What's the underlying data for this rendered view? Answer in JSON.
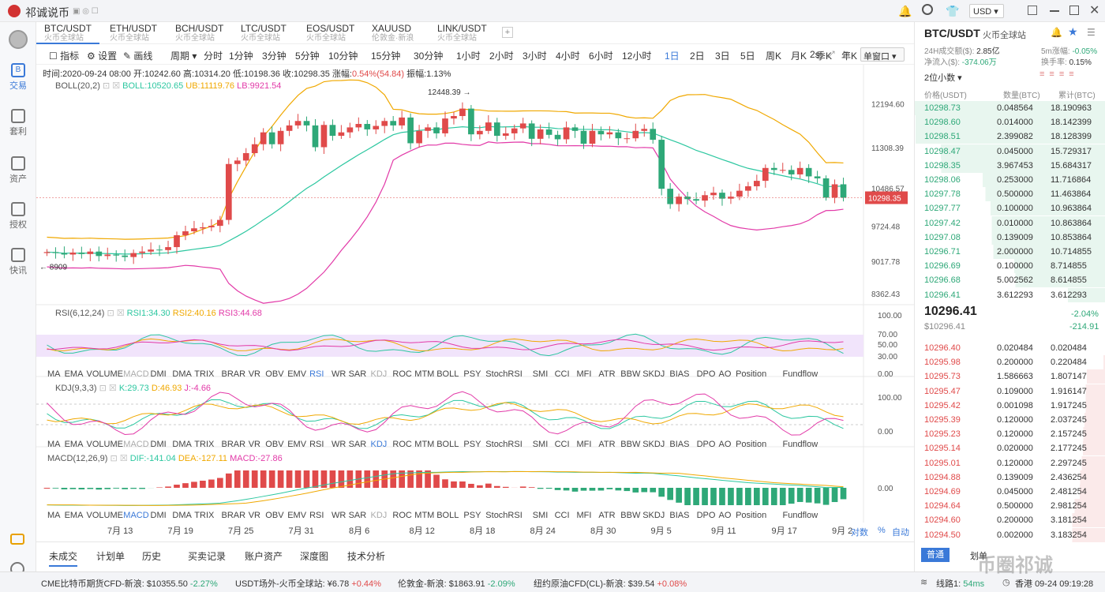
{
  "app": {
    "title": "祁诚说币",
    "currency": "USD"
  },
  "nav": [
    {
      "label": "交易",
      "icon": "trade-icon"
    },
    {
      "label": "套利",
      "icon": "arbitrage-icon"
    },
    {
      "label": "资产",
      "icon": "wallet-icon"
    },
    {
      "label": "授权",
      "icon": "key-icon"
    },
    {
      "label": "快讯",
      "icon": "news-icon"
    }
  ],
  "tabs": [
    {
      "pair": "BTC/USDT",
      "ex": "火币全球站"
    },
    {
      "pair": "ETH/USDT",
      "ex": "火币全球站"
    },
    {
      "pair": "BCH/USDT",
      "ex": "火币全球站"
    },
    {
      "pair": "LTC/USDT",
      "ex": "火币全球站"
    },
    {
      "pair": "EOS/USDT",
      "ex": "火币全球站"
    },
    {
      "pair": "XAUUSD",
      "ex": "伦敦金·新浪"
    },
    {
      "pair": "LINK/USDT",
      "ex": "火币全球站"
    }
  ],
  "toolbar": {
    "indicator": "指标",
    "settings": "设置",
    "draw": "画线",
    "period": "周期",
    "intervals": [
      "分时",
      "1分钟",
      "3分钟",
      "5分钟",
      "10分钟",
      "15分钟",
      "30分钟",
      "1小时",
      "2小时",
      "3小时",
      "4小时",
      "6小时",
      "12小时",
      "1日",
      "2日",
      "3日",
      "5日",
      "周K",
      "月K",
      "季K",
      "年K"
    ],
    "active": "1日",
    "refresh": "2s",
    "window": "单窗口"
  },
  "info": {
    "line": "时间:2020-09-24 08:00  开:10242.60  高:10314.20  低:10198.36  收:10298.35  涨幅:",
    "pct": "0.54%(54.84)",
    "amp": "振幅:1.13%"
  },
  "boll": {
    "name": "BOLL(20,2)",
    "boll": "BOLL:10520.65",
    "ub": "UB:11119.76",
    "lb": "LB:9921.54"
  },
  "rsi": {
    "name": "RSI(6,12,24)",
    "r1": "RSI1:34.30",
    "r2": "RSI2:40.16",
    "r3": "RSI3:44.68"
  },
  "kdj": {
    "name": "KDJ(9,3,3)",
    "k": "K:29.73",
    "d": "D:46.93",
    "j": "J:-4.66"
  },
  "macd": {
    "name": "MACD(12,26,9)",
    "dif": "DIF:-141.04",
    "dea": "DEA:-127.11",
    "m": "MACD:-27.86"
  },
  "indicators": [
    "MA",
    "EMA",
    "VOLUME",
    "MACD",
    "DMI",
    "DMA",
    "TRIX",
    "BRAR",
    "VR",
    "OBV",
    "EMV",
    "RSI",
    "WR",
    "SAR",
    "KDJ",
    "ROC",
    "MTM",
    "BOLL",
    "PSY",
    "StochRSI",
    "SMI",
    "CCI",
    "MFI",
    "ATR",
    "BBW",
    "SKDJ",
    "BIAS",
    "DPO",
    "AO",
    "Position",
    "Fundflow"
  ],
  "yaxis": {
    "main": [
      "12194.60",
      "11308.39",
      "10486.57",
      "9724.48",
      "9017.78",
      "8362.43"
    ],
    "last": "10298.35",
    "rsi": [
      "100.00",
      "70.00",
      "50.00",
      "30.00",
      "0.00"
    ],
    "kdj": [
      "100.00",
      "0.00"
    ],
    "macd": [
      "0.00"
    ]
  },
  "markers": {
    "high": "12448.39",
    "low": "8909"
  },
  "xaxis": [
    "7月 13",
    "7月 19",
    "7月 25",
    "7月 31",
    "8月 6",
    "8月 12",
    "8月 18",
    "8月 24",
    "8月 30",
    "9月 5",
    "9月 11",
    "9月 17",
    "9月 2"
  ],
  "axis_opts": {
    "log": "对数",
    "pct": "%",
    "auto": "自动"
  },
  "bottom_tabs": [
    "未成交",
    "计划单",
    "历史",
    "买卖记录",
    "账户资产",
    "深度图",
    "技术分析"
  ],
  "right": {
    "pair": "BTC/USDT",
    "ex": "火币全球站",
    "vol_label": "24H成交额($):",
    "vol": "2.85亿",
    "flow_label": "净流入($):",
    "flow": "-374.06万",
    "m5_label": "5m涨幅:",
    "m5": "-0.05%",
    "turn_label": "换手率:",
    "turn": "0.15%",
    "decimals": "2位小数",
    "cols": [
      "价格(USDT)",
      "数量(BTC)",
      "累计(BTC)"
    ],
    "asks": [
      [
        "10298.73",
        "0.048564",
        "18.190963"
      ],
      [
        "10298.60",
        "0.014000",
        "18.142399"
      ],
      [
        "10298.51",
        "2.399082",
        "18.128399"
      ],
      [
        "10298.47",
        "0.045000",
        "15.729317"
      ],
      [
        "10298.35",
        "3.967453",
        "15.684317"
      ],
      [
        "10298.06",
        "0.253000",
        "11.716864"
      ],
      [
        "10297.78",
        "0.500000",
        "11.463864"
      ],
      [
        "10297.77",
        "0.100000",
        "10.963864"
      ],
      [
        "10297.42",
        "0.010000",
        "10.863864"
      ],
      [
        "10297.08",
        "0.139009",
        "10.853864"
      ],
      [
        "10296.71",
        "2.000000",
        "10.714855"
      ],
      [
        "10296.69",
        "0.100000",
        "8.714855"
      ],
      [
        "10296.68",
        "5.002562",
        "8.614855"
      ],
      [
        "10296.41",
        "3.612293",
        "3.612293"
      ]
    ],
    "last": "10296.41",
    "last_usd": "$10296.41",
    "chg": "-2.04%",
    "chg_abs": "-214.91",
    "bids": [
      [
        "10296.40",
        "0.020484",
        "0.020484"
      ],
      [
        "10295.98",
        "0.200000",
        "0.220484"
      ],
      [
        "10295.73",
        "1.586663",
        "1.807147"
      ],
      [
        "10295.47",
        "0.109000",
        "1.916147"
      ],
      [
        "10295.42",
        "0.001098",
        "1.917245"
      ],
      [
        "10295.39",
        "0.120000",
        "2.037245"
      ],
      [
        "10295.23",
        "0.120000",
        "2.157245"
      ],
      [
        "10295.14",
        "0.020000",
        "2.177245"
      ],
      [
        "10295.01",
        "0.120000",
        "2.297245"
      ],
      [
        "10294.88",
        "0.139009",
        "2.436254"
      ],
      [
        "10294.69",
        "0.045000",
        "2.481254"
      ],
      [
        "10294.64",
        "0.500000",
        "2.981254"
      ],
      [
        "10294.60",
        "0.200000",
        "3.181254"
      ],
      [
        "10294.50",
        "0.002000",
        "3.183254"
      ]
    ],
    "mode": "普通",
    "mode2": "划单"
  },
  "ticker": [
    {
      "name": "CME比特币期货CFD-新浪:",
      "price": "$10355.50",
      "chg": "-2.27%",
      "dir": "down"
    },
    {
      "name": "USDT场外-火币全球站:",
      "price": "¥6.78",
      "chg": "+0.44%",
      "dir": "up"
    },
    {
      "name": "伦敦金-新浪:",
      "price": "$1863.91",
      "chg": "-2.09%",
      "dir": "down"
    },
    {
      "name": "纽约原油CFD(CL)-新浪:",
      "price": "$39.54",
      "chg": "+0.08%",
      "dir": "up"
    }
  ],
  "status": {
    "line": "线路1:",
    "ping": "54ms",
    "region": "香港",
    "time": "09-24 09:19:28"
  },
  "watermark": "币圈祁诚",
  "chart_data": {
    "type": "candlestick",
    "closes": [
      9200,
      9180,
      9150,
      9190,
      9160,
      9210,
      9120,
      9150,
      9130,
      9100,
      9180,
      9210,
      9250,
      9240,
      9300,
      9540,
      9620,
      9680,
      9700,
      9730,
      9850,
      10980,
      11050,
      11200,
      11380,
      11620,
      11380,
      11650,
      11760,
      11850,
      11760,
      11320,
      11770,
      11550,
      11620,
      11720,
      11790,
      11680,
      11750,
      11850,
      11760,
      11920,
      11400,
      11650,
      11720,
      11600,
      11900,
      11950,
      12100,
      11580,
      11650,
      11820,
      11550,
      11600,
      11700,
      11800,
      11490,
      11680,
      11570,
      11480,
      11720,
      11650,
      11390,
      11650,
      11580,
      11620,
      11500,
      11500,
      11650,
      11690,
      11470,
      10480,
      10170,
      10320,
      10270,
      10240,
      10350,
      10400,
      10280,
      10320,
      10440,
      10530,
      10640,
      10900,
      10860,
      10860,
      10770,
      10900,
      10730,
      10690,
      10300,
      10570,
      10300
    ]
  }
}
